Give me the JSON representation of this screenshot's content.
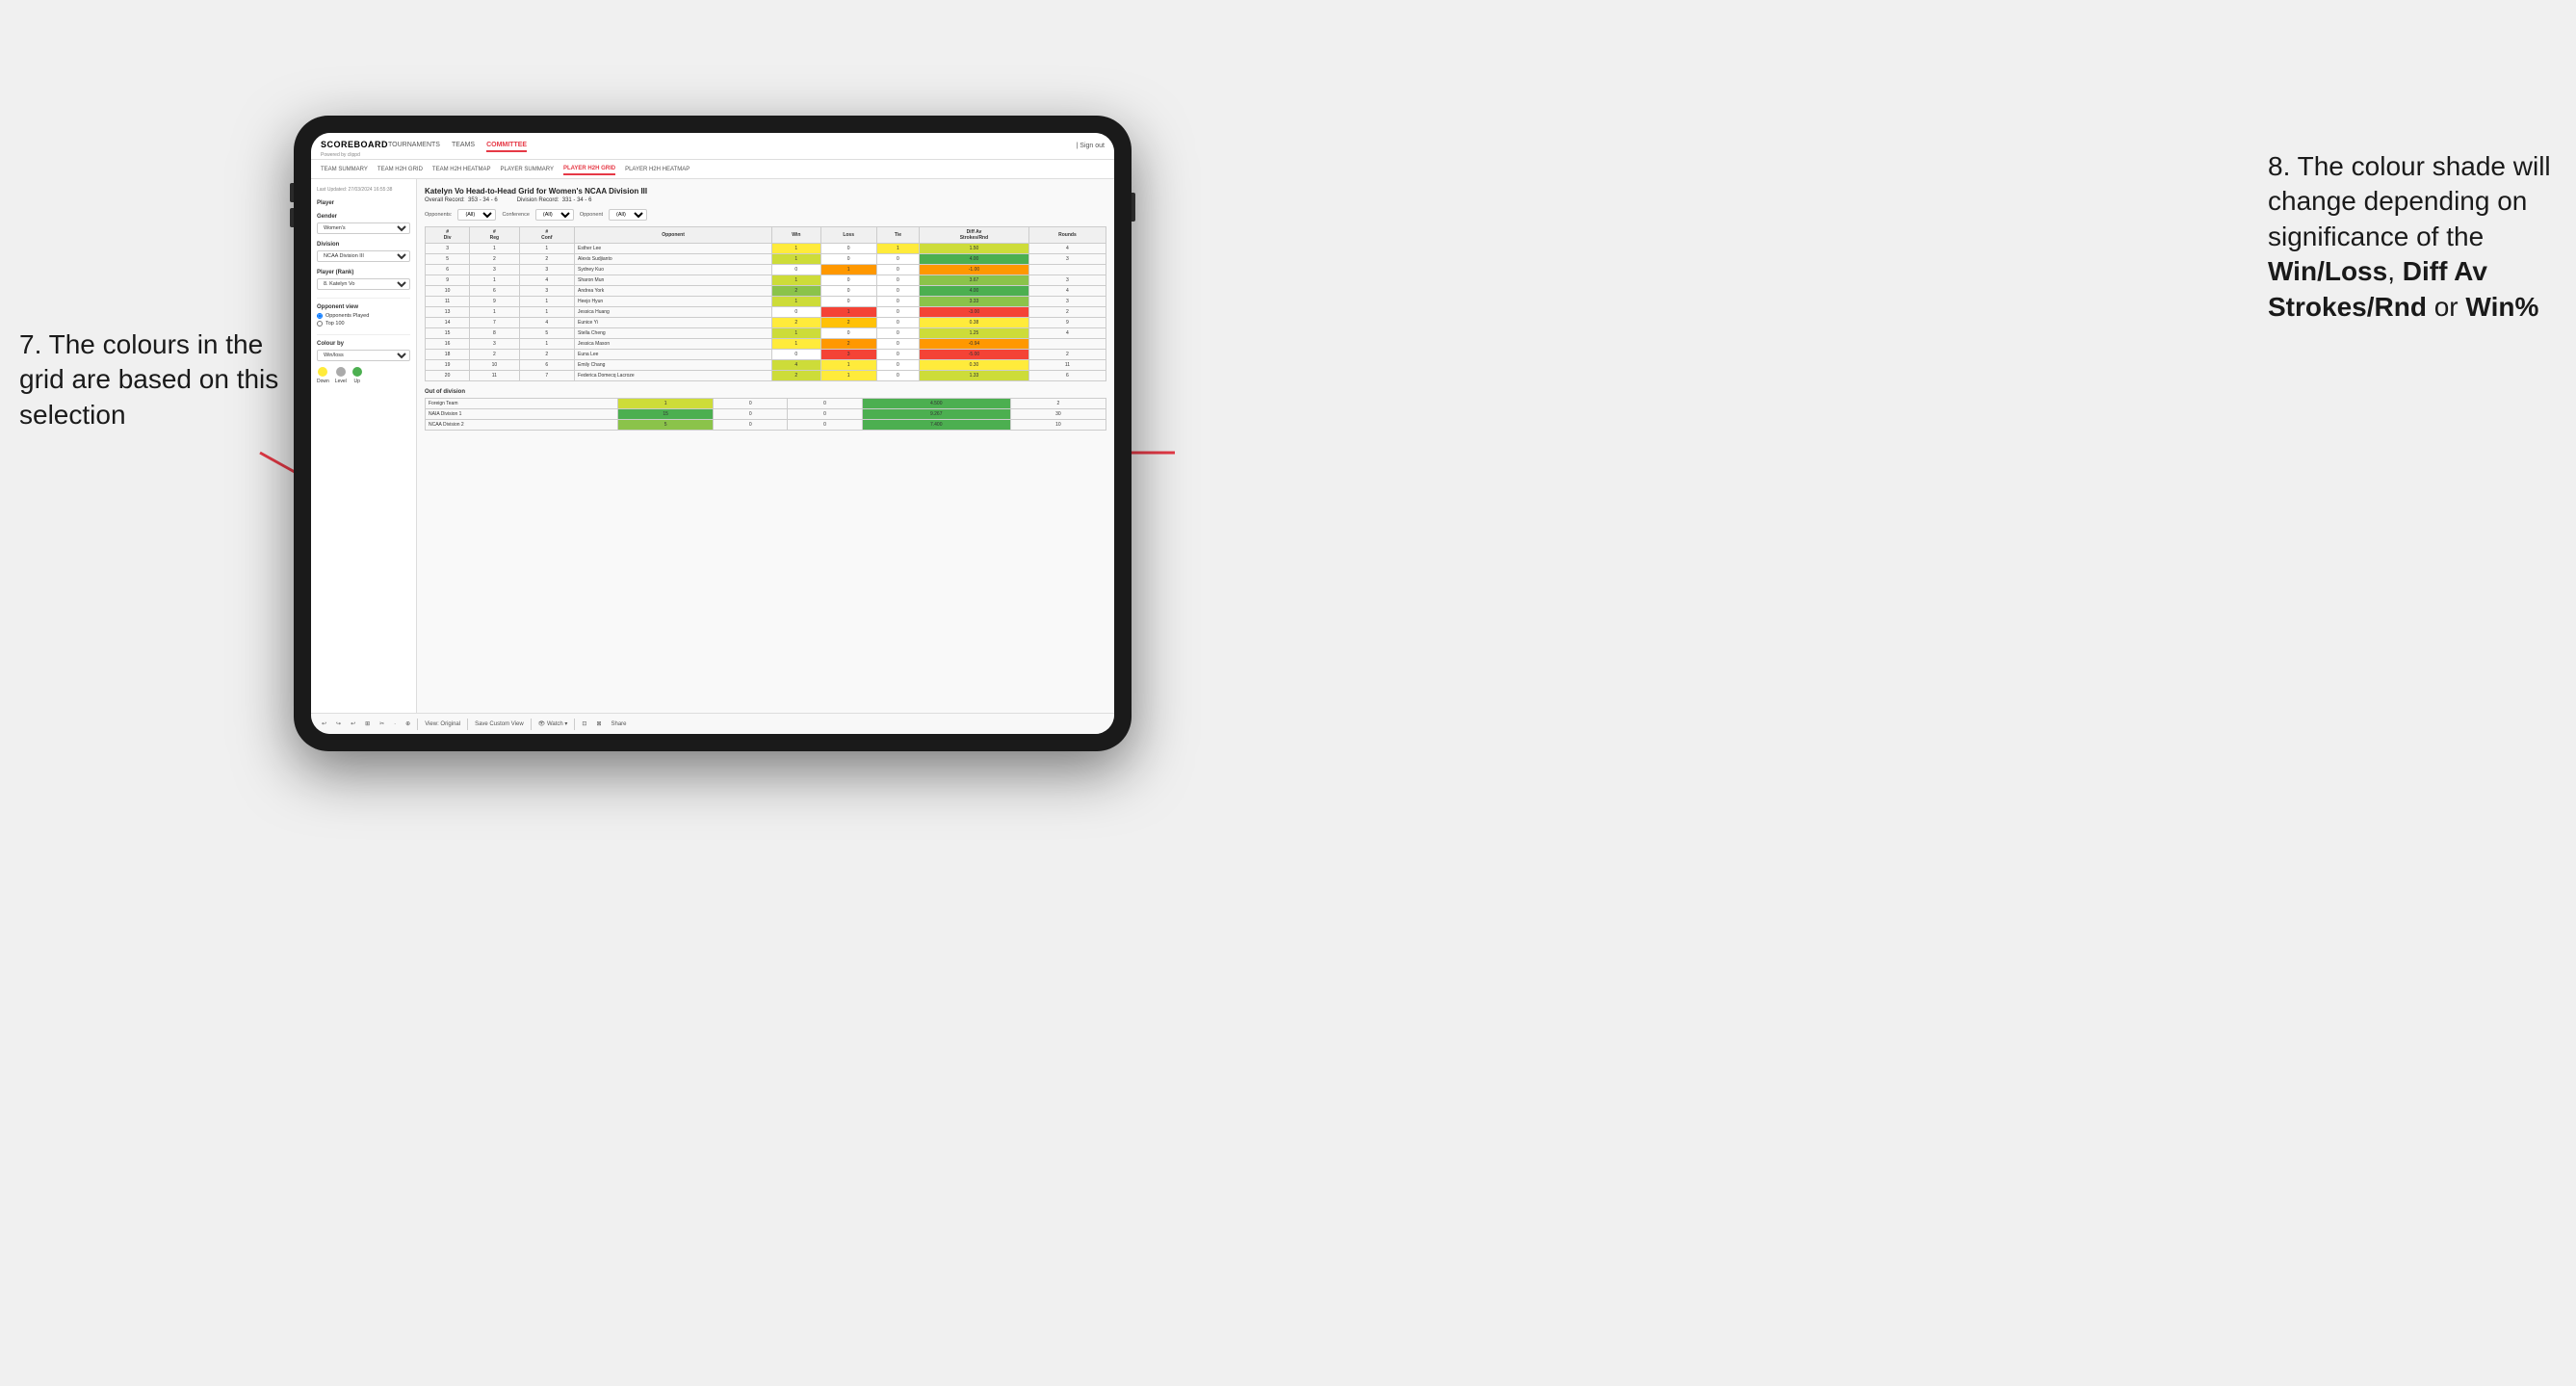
{
  "app": {
    "logo": "SCOREBOARD",
    "logo_sub": "Powered by clippd",
    "nav_links": [
      "TOURNAMENTS",
      "TEAMS",
      "COMMITTEE"
    ],
    "nav_right": [
      "| Sign out"
    ],
    "sub_nav": [
      "TEAM SUMMARY",
      "TEAM H2H GRID",
      "TEAM H2H HEATMAP",
      "PLAYER SUMMARY",
      "PLAYER H2H GRID",
      "PLAYER H2H HEATMAP"
    ]
  },
  "sidebar": {
    "timestamp": "Last Updated: 27/03/2024 16:55:38",
    "player_label": "Player",
    "gender_label": "Gender",
    "gender_value": "Women's",
    "division_label": "Division",
    "division_value": "NCAA Division III",
    "player_rank_label": "Player (Rank)",
    "player_rank_value": "8. Katelyn Vo",
    "opponent_view_label": "Opponent view",
    "opponent_played_label": "Opponents Played",
    "top100_label": "Top 100",
    "colour_by_label": "Colour by",
    "colour_by_value": "Win/loss",
    "legend": {
      "down_label": "Down",
      "level_label": "Level",
      "up_label": "Up"
    }
  },
  "grid": {
    "title": "Katelyn Vo Head-to-Head Grid for Women's NCAA Division III",
    "overall_record_label": "Overall Record:",
    "overall_record": "353 - 34 - 6",
    "division_record_label": "Division Record:",
    "division_record": "331 - 34 - 6",
    "filter_opponents_label": "Opponents:",
    "filter_opponents_value": "(All)",
    "filter_conference_label": "Conference",
    "filter_conference_value": "(All)",
    "filter_opponent_label": "Opponent",
    "filter_opponent_value": "(All)",
    "col_headers": [
      "#\nDiv",
      "#\nReg",
      "#\nConf",
      "Opponent",
      "Win",
      "Loss",
      "Tie",
      "Diff Av\nStrokes/Rnd",
      "Rounds"
    ],
    "rows": [
      {
        "div": "3",
        "reg": "1",
        "conf": "1",
        "name": "Esther Lee",
        "win": 1,
        "loss": 0,
        "tie": 1,
        "diff": 1.5,
        "rounds": 4,
        "win_class": "cell-yellow",
        "loss_class": "cell-white",
        "tie_class": "cell-yellow",
        "diff_class": "cell-green-light"
      },
      {
        "div": "5",
        "reg": "2",
        "conf": "2",
        "name": "Alexis Sudjianto",
        "win": 1,
        "loss": 0,
        "tie": 0,
        "diff": 4.0,
        "rounds": 3,
        "win_class": "cell-green-light",
        "loss_class": "cell-white",
        "tie_class": "cell-white",
        "diff_class": "cell-green-dark"
      },
      {
        "div": "6",
        "reg": "3",
        "conf": "3",
        "name": "Sydney Kuo",
        "win": 0,
        "loss": 1,
        "tie": 0,
        "diff": -1.0,
        "rounds": "",
        "win_class": "cell-white",
        "loss_class": "cell-red-light",
        "tie_class": "cell-white",
        "diff_class": "cell-red-light"
      },
      {
        "div": "9",
        "reg": "1",
        "conf": "4",
        "name": "Sharon Mun",
        "win": 1,
        "loss": 0,
        "tie": 0,
        "diff": 3.67,
        "rounds": 3,
        "win_class": "cell-green-light",
        "loss_class": "cell-white",
        "tie_class": "cell-white",
        "diff_class": "cell-green-mid"
      },
      {
        "div": "10",
        "reg": "6",
        "conf": "3",
        "name": "Andrea York",
        "win": 2,
        "loss": 0,
        "tie": 0,
        "diff": 4.0,
        "rounds": 4,
        "win_class": "cell-green-mid",
        "loss_class": "cell-white",
        "tie_class": "cell-white",
        "diff_class": "cell-green-dark"
      },
      {
        "div": "11",
        "reg": "9",
        "conf": "1",
        "name": "Heejo Hyun",
        "win": 1,
        "loss": 0,
        "tie": 0,
        "diff": 3.33,
        "rounds": 3,
        "win_class": "cell-green-light",
        "loss_class": "cell-white",
        "tie_class": "cell-white",
        "diff_class": "cell-green-mid"
      },
      {
        "div": "13",
        "reg": "1",
        "conf": "1",
        "name": "Jessica Huang",
        "win": 0,
        "loss": 1,
        "tie": 0,
        "diff": -3.0,
        "rounds": 2,
        "win_class": "cell-white",
        "loss_class": "cell-red",
        "tie_class": "cell-white",
        "diff_class": "cell-red"
      },
      {
        "div": "14",
        "reg": "7",
        "conf": "4",
        "name": "Eunice Yi",
        "win": 2,
        "loss": 2,
        "tie": 0,
        "diff": 0.38,
        "rounds": 9,
        "win_class": "cell-yellow",
        "loss_class": "cell-orange-light",
        "tie_class": "cell-white",
        "diff_class": "cell-yellow"
      },
      {
        "div": "15",
        "reg": "8",
        "conf": "5",
        "name": "Stella Cheng",
        "win": 1,
        "loss": 0,
        "tie": 0,
        "diff": 1.25,
        "rounds": 4,
        "win_class": "cell-green-light",
        "loss_class": "cell-white",
        "tie_class": "cell-white",
        "diff_class": "cell-green-light"
      },
      {
        "div": "16",
        "reg": "3",
        "conf": "1",
        "name": "Jessica Mason",
        "win": 1,
        "loss": 2,
        "tie": 0,
        "diff": -0.94,
        "rounds": "",
        "win_class": "cell-yellow",
        "loss_class": "cell-red-light",
        "tie_class": "cell-white",
        "diff_class": "cell-red-light"
      },
      {
        "div": "18",
        "reg": "2",
        "conf": "2",
        "name": "Euna Lee",
        "win": 0,
        "loss": 3,
        "tie": 0,
        "diff": -5.0,
        "rounds": 2,
        "win_class": "cell-white",
        "loss_class": "cell-red",
        "tie_class": "cell-white",
        "diff_class": "cell-red"
      },
      {
        "div": "19",
        "reg": "10",
        "conf": "6",
        "name": "Emily Chang",
        "win": 4,
        "loss": 1,
        "tie": 0,
        "diff": 0.3,
        "rounds": 11,
        "win_class": "cell-green-light",
        "loss_class": "cell-yellow",
        "tie_class": "cell-white",
        "diff_class": "cell-yellow"
      },
      {
        "div": "20",
        "reg": "11",
        "conf": "7",
        "name": "Federica Domecq Lacroze",
        "win": 2,
        "loss": 1,
        "tie": 0,
        "diff": 1.33,
        "rounds": 6,
        "win_class": "cell-green-light",
        "loss_class": "cell-yellow",
        "tie_class": "cell-white",
        "diff_class": "cell-green-light"
      }
    ],
    "out_of_division_label": "Out of division",
    "out_of_division_rows": [
      {
        "name": "Foreign Team",
        "win": 1,
        "loss": 0,
        "tie": 0,
        "diff": 4.5,
        "rounds": 2,
        "win_class": "cell-green-light",
        "diff_class": "cell-green-dark"
      },
      {
        "name": "NAIA Division 1",
        "win": 15,
        "loss": 0,
        "tie": 0,
        "diff": 9.267,
        "rounds": 30,
        "win_class": "cell-green-dark",
        "diff_class": "cell-green-dark"
      },
      {
        "name": "NCAA Division 2",
        "win": 5,
        "loss": 0,
        "tie": 0,
        "diff": 7.4,
        "rounds": 10,
        "win_class": "cell-green-mid",
        "diff_class": "cell-green-dark"
      }
    ],
    "toolbar_items": [
      "↩",
      "↪",
      "↩",
      "⊞",
      "✂",
      "·",
      "⊕",
      "|",
      "View: Original",
      "|",
      "Save Custom View",
      "|",
      "👁 Watch ▾",
      "|",
      "⊡",
      "⊠",
      "Share"
    ]
  },
  "annotation_left": {
    "text": "7. The colours in the grid are based on this selection"
  },
  "annotation_right": {
    "line1": "8. The colour shade will change depending on significance of the",
    "bold1": "Win/Loss",
    "line2": ", ",
    "bold2": "Diff Av Strokes/Rnd",
    "line3": " or ",
    "bold3": "Win%"
  }
}
